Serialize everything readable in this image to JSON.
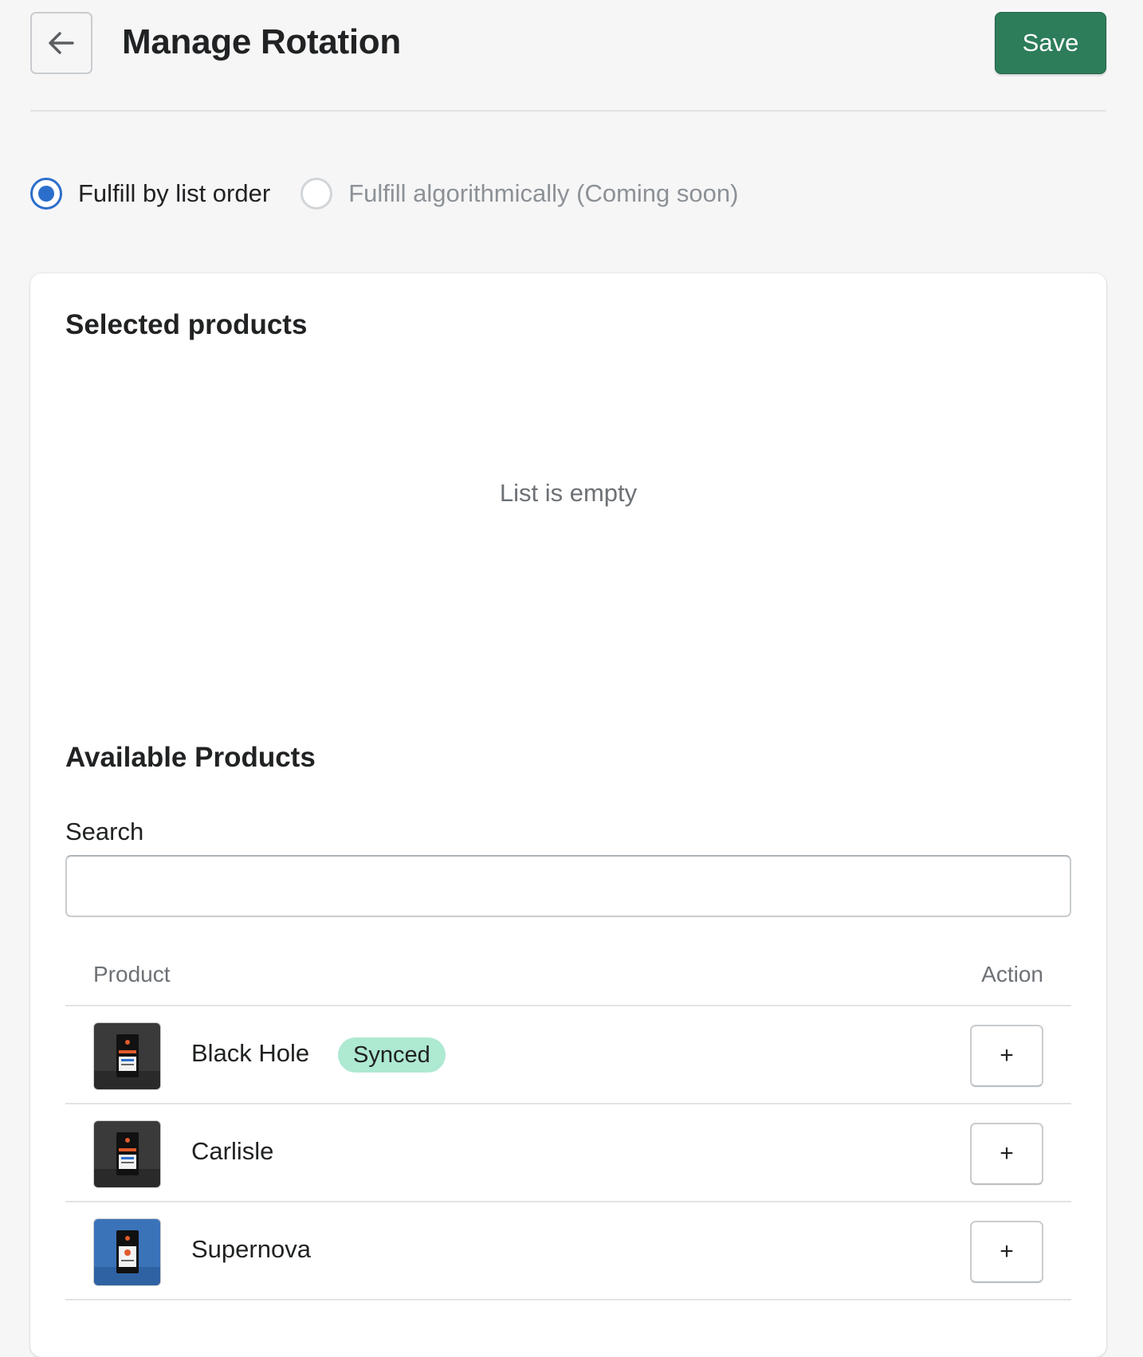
{
  "header": {
    "title": "Manage Rotation",
    "save_label": "Save"
  },
  "fulfillment": {
    "options": [
      {
        "label": "Fulfill by list order",
        "selected": true,
        "disabled": false
      },
      {
        "label": "Fulfill algorithmically (Coming soon)",
        "selected": false,
        "disabled": true
      }
    ]
  },
  "selected_products": {
    "title": "Selected products",
    "empty_text": "List is empty"
  },
  "available_products": {
    "title": "Available Products",
    "search_label": "Search",
    "search_value": "",
    "columns": [
      "Product",
      "Action"
    ],
    "rows": [
      {
        "name": "Black Hole",
        "badge": "Synced",
        "thumb_color": "#3a3a3a",
        "action": "+"
      },
      {
        "name": "Carlisle",
        "badge": "",
        "thumb_color": "#3a3a3a",
        "action": "+"
      },
      {
        "name": "Supernova",
        "badge": "",
        "thumb_color": "#3b73b9",
        "action": "+"
      }
    ]
  },
  "colors": {
    "primary": "#2d7d5a",
    "radio_selected": "#2c6ecb",
    "badge_success": "#aee9d1"
  }
}
